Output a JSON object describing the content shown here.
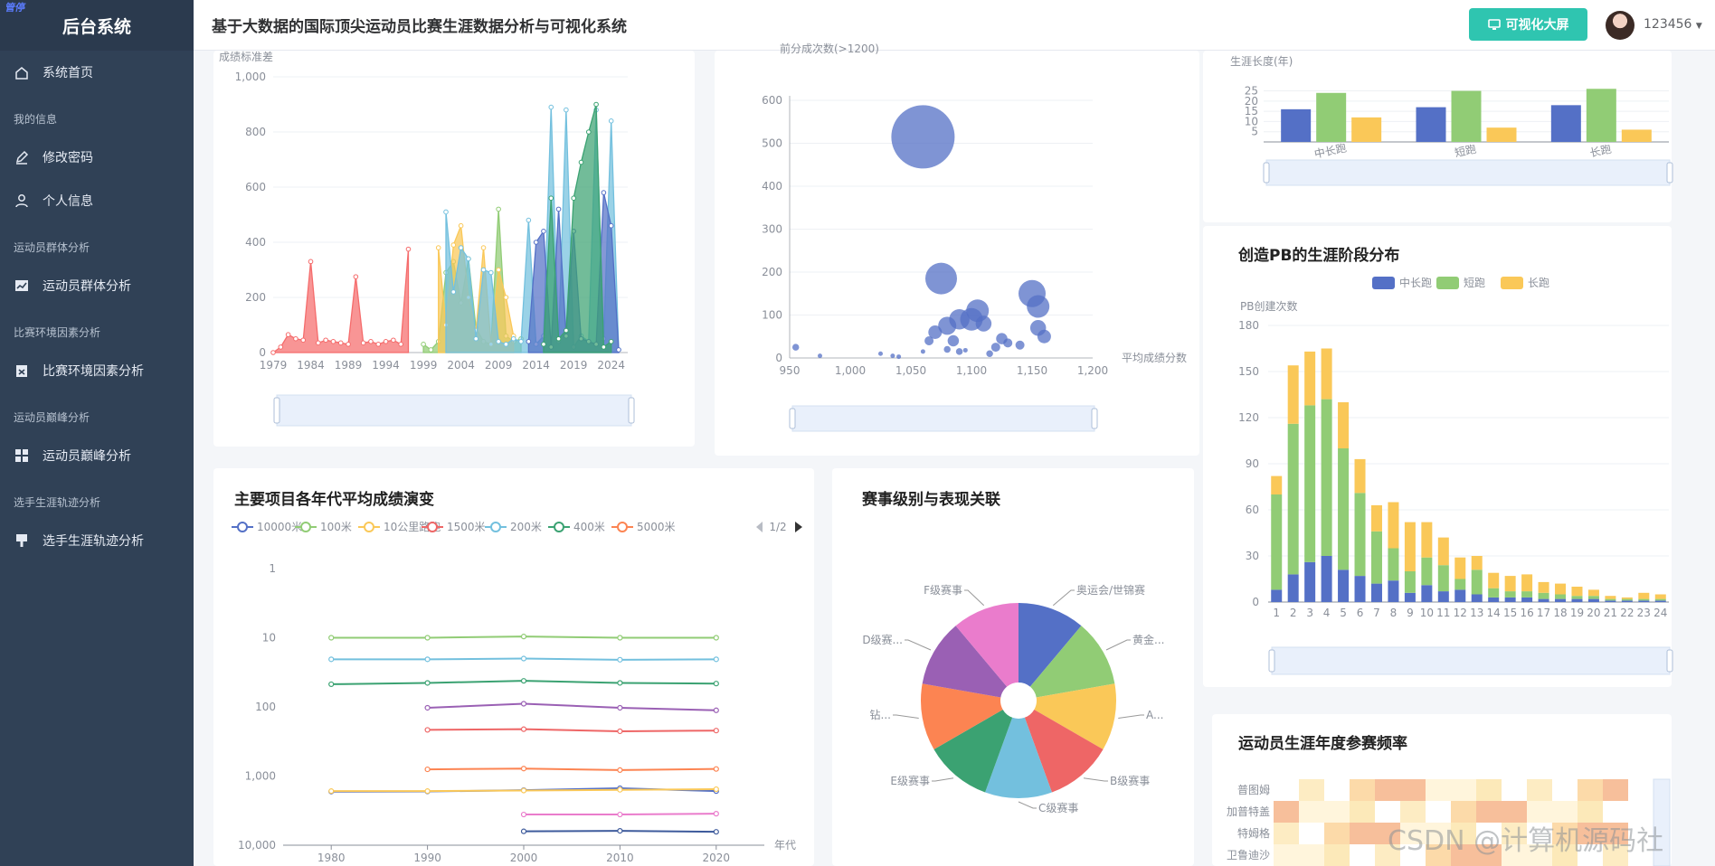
{
  "sidebar": {
    "logo_text": "管停",
    "app_title": "后台系统",
    "items": [
      {
        "type": "item",
        "label": "系统首页",
        "icon": "home-icon"
      },
      {
        "type": "group",
        "label": "我的信息"
      },
      {
        "type": "item",
        "label": "修改密码",
        "icon": "edit-icon"
      },
      {
        "type": "item",
        "label": "个人信息",
        "icon": "user-icon"
      },
      {
        "type": "group",
        "label": "运动员群体分析"
      },
      {
        "type": "item",
        "label": "运动员群体分析",
        "icon": "chart-icon"
      },
      {
        "type": "group",
        "label": "比赛环境因素分析"
      },
      {
        "type": "item",
        "label": "比赛环境因素分析",
        "icon": "clipboard-icon"
      },
      {
        "type": "group",
        "label": "运动员巅峰分析"
      },
      {
        "type": "item",
        "label": "运动员巅峰分析",
        "icon": "grid-icon"
      },
      {
        "type": "group",
        "label": "选手生涯轨迹分析"
      },
      {
        "type": "item",
        "label": "选手生涯轨迹分析",
        "icon": "pin-icon"
      }
    ]
  },
  "header": {
    "title": "基于大数据的国际顶尖运动员比赛生涯数据分析与可视化系统",
    "screen_button": "可视化大屏",
    "user_name": "123456",
    "colors": {
      "accent": "#2fc5b0",
      "sidebar": "#304156"
    }
  },
  "watermark": "CSDN @计算机源码社",
  "chart_data": [
    {
      "id": "score-std-area",
      "type": "area",
      "ylabel": "成绩标准差",
      "x_ticks": [
        "1979",
        "1984",
        "1989",
        "1994",
        "1999",
        "2004",
        "2009",
        "2014",
        "2019",
        "2024"
      ],
      "ylim": [
        0,
        1000
      ],
      "y_ticks": [
        "0",
        "200",
        "400",
        "600",
        "800",
        "1,000"
      ],
      "series": [
        {
          "color": "#f56c6c",
          "x": [
            1979,
            1980,
            1981,
            1982,
            1983,
            1984,
            1985,
            1986,
            1987,
            1988,
            1989,
            1990,
            1991,
            1992,
            1993,
            1994,
            1995,
            1996,
            1997
          ],
          "values": [
            0,
            20,
            65,
            50,
            45,
            330,
            35,
            45,
            40,
            35,
            30,
            275,
            35,
            40,
            30,
            40,
            45,
            30,
            375
          ]
        },
        {
          "color": "#91cc75",
          "x": [
            1999,
            2000,
            2001,
            2002,
            2003,
            2004,
            2005,
            2006,
            2007,
            2008,
            2009,
            2010,
            2011,
            2012
          ],
          "values": [
            30,
            10,
            40,
            290,
            330,
            180,
            340,
            90,
            40,
            30,
            520,
            60,
            40,
            50
          ]
        },
        {
          "color": "#fac858",
          "x": [
            2001,
            2002,
            2003,
            2004,
            2005,
            2006,
            2007,
            2008,
            2009,
            2010,
            2011
          ],
          "values": [
            380,
            100,
            390,
            460,
            200,
            80,
            380,
            30,
            300,
            200,
            60
          ]
        },
        {
          "color": "#73c0de",
          "x": [
            2002,
            2003,
            2004,
            2005,
            2006,
            2007,
            2008,
            2009,
            2010,
            2011,
            2012,
            2013,
            2014,
            2015,
            2016,
            2017,
            2018,
            2019,
            2020,
            2021,
            2022,
            2023,
            2024,
            2025
          ],
          "values": [
            510,
            220,
            380,
            340,
            50,
            300,
            290,
            40,
            30,
            50,
            40,
            480,
            30,
            60,
            890,
            40,
            880,
            20,
            60,
            40,
            880,
            50,
            840,
            10
          ]
        },
        {
          "color": "#5470c6",
          "x": [
            2013,
            2014,
            2015,
            2016,
            2017,
            2018,
            2019,
            2020,
            2021,
            2022,
            2023,
            2024,
            2025
          ],
          "values": [
            40,
            400,
            440,
            20,
            520,
            60,
            440,
            50,
            40,
            30,
            580,
            460,
            10
          ]
        },
        {
          "color": "#3ba272",
          "x": [
            2015,
            2016,
            2017,
            2018,
            2019,
            2020,
            2021,
            2022,
            2023,
            2024
          ],
          "values": [
            30,
            560,
            50,
            80,
            560,
            690,
            800,
            900,
            20,
            40
          ]
        }
      ]
    },
    {
      "id": "bubble-scatter",
      "type": "scatter",
      "ylabel": "前分成次数(>1200)",
      "xlabel": "平均成绩分数",
      "xlim": [
        950,
        1200
      ],
      "ylim": [
        0,
        600
      ],
      "x_ticks": [
        "950",
        "1,000",
        "1,050",
        "1,100",
        "1,150",
        "1,200"
      ],
      "y_ticks": [
        "0",
        "100",
        "200",
        "300",
        "400",
        "500",
        "600"
      ],
      "color": "#5470c6",
      "points": [
        [
          1060,
          515,
          28
        ],
        [
          1075,
          185,
          14
        ],
        [
          1150,
          150,
          12
        ],
        [
          1155,
          120,
          10
        ],
        [
          1105,
          110,
          10
        ],
        [
          1100,
          90,
          10
        ],
        [
          1090,
          90,
          9
        ],
        [
          1080,
          75,
          8
        ],
        [
          1155,
          70,
          7
        ],
        [
          1160,
          50,
          6
        ],
        [
          1110,
          80,
          7
        ],
        [
          1070,
          60,
          6
        ],
        [
          1085,
          40,
          5
        ],
        [
          1125,
          45,
          5
        ],
        [
          1120,
          25,
          4
        ],
        [
          1130,
          35,
          4
        ],
        [
          1140,
          30,
          4
        ],
        [
          1065,
          40,
          4
        ],
        [
          1080,
          20,
          3
        ],
        [
          1090,
          15,
          3
        ],
        [
          1115,
          10,
          3
        ],
        [
          955,
          25,
          3
        ],
        [
          975,
          5,
          2
        ],
        [
          1025,
          10,
          2
        ],
        [
          1035,
          5,
          2
        ],
        [
          1040,
          3,
          2
        ],
        [
          1060,
          15,
          2
        ],
        [
          1095,
          18,
          2
        ]
      ]
    },
    {
      "id": "career-length-bar",
      "type": "bar",
      "ylabel": "生涯长度(年)",
      "categories": [
        "中长跑",
        "短跑",
        "长跑"
      ],
      "y_ticks": [
        "5",
        "10",
        "15",
        "20",
        "25"
      ],
      "ylim": [
        0,
        27
      ],
      "series": [
        {
          "color": "#5470c6",
          "values": [
            16,
            17,
            18
          ]
        },
        {
          "color": "#91cc75",
          "values": [
            24,
            25,
            26
          ]
        },
        {
          "color": "#fac858",
          "values": [
            12,
            7,
            6
          ]
        }
      ]
    },
    {
      "id": "pb-stage-bar",
      "type": "bar",
      "title": "创造PB的生涯阶段分布",
      "ylabel": "PB创建次数",
      "legend": [
        "中长跑",
        "短跑",
        "长跑"
      ],
      "categories": [
        "1",
        "2",
        "3",
        "4",
        "5",
        "6",
        "7",
        "8",
        "9",
        "10",
        "11",
        "12",
        "13",
        "14",
        "15",
        "16",
        "17",
        "18",
        "19",
        "20",
        "21",
        "22",
        "23",
        "24"
      ],
      "ylim": [
        0,
        180
      ],
      "y_ticks": [
        "0",
        "30",
        "60",
        "90",
        "120",
        "150",
        "180"
      ],
      "series": [
        {
          "name": "中长跑",
          "color": "#5470c6",
          "values": [
            8,
            18,
            26,
            30,
            21,
            17,
            12,
            14,
            6,
            11,
            7,
            8,
            5,
            3,
            3,
            3,
            2,
            2,
            2,
            2,
            1,
            1,
            1,
            1
          ]
        },
        {
          "name": "短跑",
          "color": "#91cc75",
          "values": [
            62,
            98,
            102,
            102,
            79,
            54,
            34,
            21,
            14,
            18,
            17,
            7,
            16,
            6,
            4,
            4,
            4,
            3,
            2,
            2,
            1,
            1,
            1,
            1
          ]
        },
        {
          "name": "长跑",
          "color": "#fac858",
          "values": [
            12,
            38,
            35,
            33,
            30,
            22,
            17,
            30,
            32,
            23,
            18,
            14,
            9,
            10,
            10,
            11,
            7,
            7,
            6,
            4,
            2,
            1,
            4,
            3
          ]
        }
      ]
    },
    {
      "id": "decade-avg-line",
      "type": "line",
      "title": "主要项目各年代平均成绩演变",
      "legend": [
        "10000米",
        "100米",
        "10公里路跑",
        "1500米",
        "200米",
        "400米",
        "5000米"
      ],
      "legend_page": "1/2",
      "xlabel": "年代",
      "x_ticks": [
        "1980",
        "1990",
        "2000",
        "2010",
        "2020"
      ],
      "y_scale": "log",
      "y_ticks": [
        "1",
        "10",
        "100",
        "1,000",
        "10,000"
      ],
      "series": [
        {
          "color": "#91cc75",
          "x": [
            1980,
            1990,
            2000,
            2010,
            2020
          ],
          "values": [
            10,
            10,
            9.6,
            10,
            10
          ]
        },
        {
          "color": "#73c0de",
          "x": [
            1980,
            1990,
            2000,
            2010,
            2020
          ],
          "values": [
            20.5,
            20.5,
            20,
            20.8,
            20.5
          ]
        },
        {
          "color": "#3ba272",
          "x": [
            1980,
            1990,
            2000,
            2010,
            2020
          ],
          "values": [
            47,
            45,
            42,
            45,
            46
          ]
        },
        {
          "color": "#9a60b4",
          "x": [
            1990,
            2000,
            2010,
            2020
          ],
          "values": [
            103,
            90,
            103,
            112
          ]
        },
        {
          "color": "#ee6666",
          "x": [
            1990,
            2000,
            2010,
            2020
          ],
          "values": [
            215,
            210,
            225,
            220
          ]
        },
        {
          "color": "#fc8452",
          "x": [
            1990,
            2000,
            2010,
            2020
          ],
          "values": [
            800,
            780,
            820,
            790
          ]
        },
        {
          "color": "#5470c6",
          "x": [
            1980,
            1990,
            2000,
            2010,
            2020
          ],
          "values": [
            1680,
            1670,
            1600,
            1500,
            1650
          ]
        },
        {
          "color": "#fac858",
          "x": [
            1980,
            1990,
            2000,
            2010,
            2020
          ],
          "values": [
            1650,
            1650,
            1620,
            1580,
            1550
          ]
        },
        {
          "color": "#ea7ccc",
          "x": [
            2000,
            2010,
            2020
          ],
          "values": [
            3600,
            3600,
            3500
          ]
        },
        {
          "color": "#3e5b9c",
          "x": [
            2000,
            2010,
            2020
          ],
          "values": [
            6300,
            6200,
            6400
          ]
        }
      ]
    },
    {
      "id": "event-level-rose",
      "type": "pie",
      "title": "赛事级别与表现关联",
      "slices": [
        {
          "label": "奥运会/世锦赛",
          "color": "#5470c6",
          "value": 1.0
        },
        {
          "label": "黄金...",
          "color": "#91cc75",
          "value": 1.0
        },
        {
          "label": "A...",
          "color": "#fac858",
          "value": 1.0
        },
        {
          "label": "B级赛事",
          "color": "#ee6666",
          "value": 1.0
        },
        {
          "label": "C级赛事",
          "color": "#73c0de",
          "value": 1.0
        },
        {
          "label": "E级赛事",
          "color": "#3ba272",
          "value": 1.0
        },
        {
          "label": "钻...",
          "color": "#fc8452",
          "value": 1.0
        },
        {
          "label": "D级赛...",
          "color": "#9a60b4",
          "value": 1.0
        },
        {
          "label": "F级赛事",
          "color": "#ea7ccc",
          "value": 1.0
        }
      ]
    },
    {
      "id": "yearly-freq-heatmap",
      "type": "heatmap",
      "title": "运动员生涯年度参赛频率",
      "y_categories": [
        "普图姆",
        "加普特盖",
        "特姆格",
        "卫鲁迪沙"
      ]
    }
  ]
}
